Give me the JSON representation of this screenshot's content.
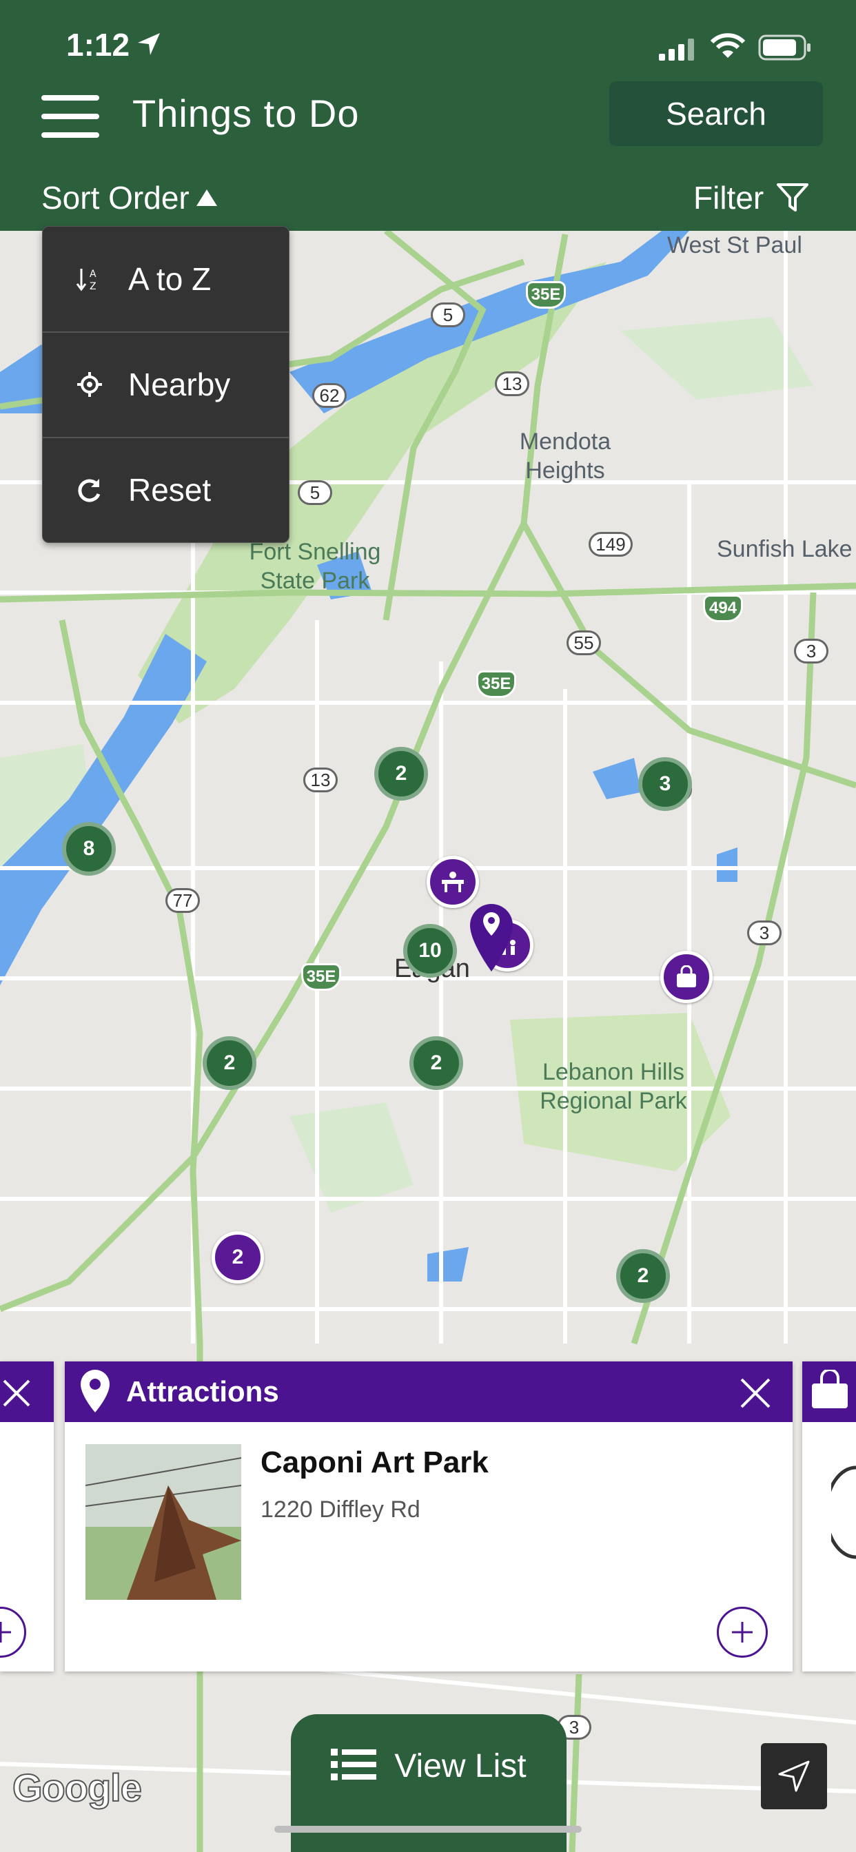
{
  "status": {
    "time": "1:12"
  },
  "header": {
    "title": "Things to Do",
    "search_label": "Search"
  },
  "toolbar": {
    "sort_label": "Sort Order",
    "filter_label": "Filter"
  },
  "sort_menu": {
    "items": [
      {
        "label": "A to Z",
        "icon": "sort-az-icon"
      },
      {
        "label": "Nearby",
        "icon": "crosshair-icon"
      },
      {
        "label": "Reset",
        "icon": "reset-icon"
      }
    ]
  },
  "map": {
    "places": [
      "West St Paul",
      "Mendota Heights",
      "Sunfish Lake",
      "Fort Snelling State Park",
      "Eagan",
      "Lebanon Hills Regional Park"
    ],
    "routes": [
      "5",
      "35E",
      "13",
      "62",
      "5",
      "149",
      "494",
      "55",
      "3",
      "35E",
      "13",
      "149",
      "77",
      "3",
      "35E",
      "3"
    ],
    "clusters": [
      "2",
      "3",
      "8",
      "10",
      "2",
      "2",
      "2"
    ],
    "purple_cluster": "2",
    "attribution": "Google"
  },
  "card": {
    "category": "Attractions",
    "name": "Caponi Art Park",
    "address": "1220 Diffley Rd"
  },
  "view_list_label": "View List",
  "colors": {
    "brand_green": "#2c5f3c",
    "accent_purple": "#4c1390"
  }
}
